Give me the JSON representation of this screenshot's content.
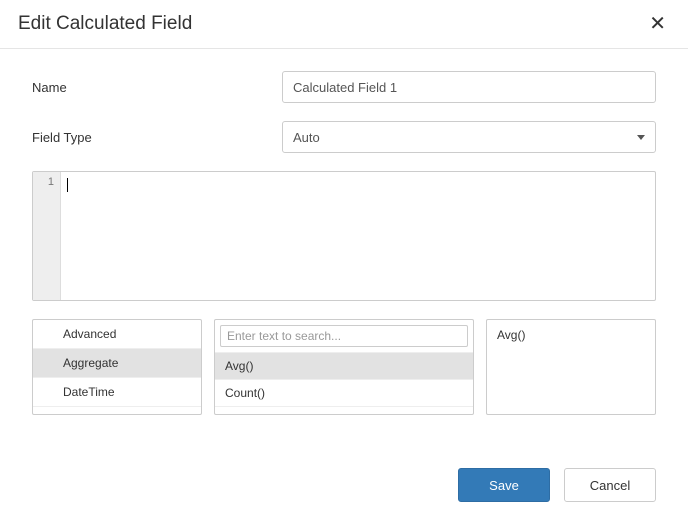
{
  "dialog": {
    "title": "Edit Calculated Field"
  },
  "form": {
    "name_label": "Name",
    "name_value": "Calculated Field 1",
    "field_type_label": "Field Type",
    "field_type_value": "Auto"
  },
  "editor": {
    "line_number": "1",
    "content": ""
  },
  "categories": {
    "items": [
      {
        "label": "Advanced",
        "selected": false
      },
      {
        "label": "Aggregate",
        "selected": true
      },
      {
        "label": "DateTime",
        "selected": false
      }
    ]
  },
  "functions": {
    "search_placeholder": "Enter text to search...",
    "items": [
      {
        "label": "Avg()",
        "selected": true
      },
      {
        "label": "Count()",
        "selected": false
      }
    ]
  },
  "description": {
    "text": "Avg()"
  },
  "footer": {
    "save_label": "Save",
    "cancel_label": "Cancel"
  }
}
